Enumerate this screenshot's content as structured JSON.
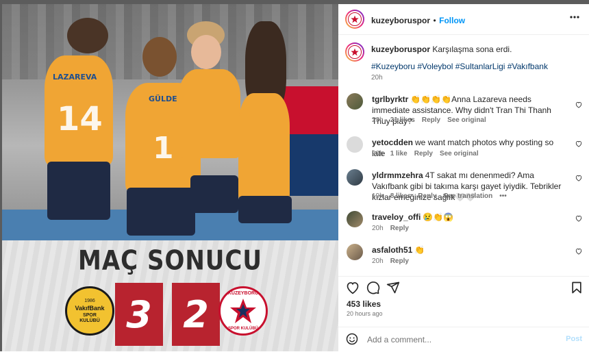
{
  "post": {
    "username": "kuzeyboruspor",
    "follow_label": "Follow",
    "separator": "•",
    "more_icon": "more-horizontal-icon",
    "caption_text": "Karşılaşma sona erdi.",
    "hashtags": "#Kuzeyboru #Voleybol #SultanlarLigi #Vakıfbank",
    "caption_time": "20h",
    "likes": "453 likes",
    "time_ago": "20 hours ago"
  },
  "image": {
    "result_title": "MAÇ SONUCU",
    "home_score": "3",
    "away_score": "2",
    "home_logo_year": "1986",
    "home_logo_name": "VakıfBank",
    "home_logo_sub1": "SPOR",
    "home_logo_sub2": "KULÜBÜ",
    "away_logo_top": "KUZEYBORU",
    "away_logo_bottom": "SPOR KULÜBÜ",
    "jersey_name_1": "LAZAREVA",
    "jersey_number_1": "14",
    "jersey_name_2": "GÜLDE",
    "jersey_number_2": "1"
  },
  "comments": [
    {
      "user": "tgrlbyrktr",
      "text": "👏👏👏👏Anna Lazareva needs immediate assistance. Why didn't Tran Thi Thanh Thuy play?",
      "time": "20h",
      "likes": "21 likes",
      "reply": "Reply",
      "extra": "See original"
    },
    {
      "user": "yetocdden",
      "text": "we want match photos why posting so late",
      "time": "20h",
      "likes": "1 like",
      "reply": "Reply",
      "extra": "See original"
    },
    {
      "user": "yldrmmzehra",
      "text": "4T sakat mı denenmedi? Ama Vakıfbank gibi bi takıma karşı gayet iyiydik. Tebrikler kızlar emeğinize sağlık🤍🤍",
      "time": "19h",
      "likes": "8 likes",
      "reply": "Reply",
      "extra": "See translation",
      "dots": "•••"
    },
    {
      "user": "traveloy_offi",
      "text": "😢👏😱",
      "time": "20h",
      "reply": "Reply"
    },
    {
      "user": "asfaloth51",
      "text": "👏",
      "time": "20h",
      "reply": "Reply"
    }
  ],
  "composer": {
    "placeholder": "Add a comment...",
    "post_label": "Post",
    "emoji_icon": "smiley-icon"
  },
  "colors": {
    "accent": "#0095f6",
    "link": "#00376b",
    "muted": "#737373",
    "score_box": "#b8232f",
    "jersey": "#f0a534"
  }
}
